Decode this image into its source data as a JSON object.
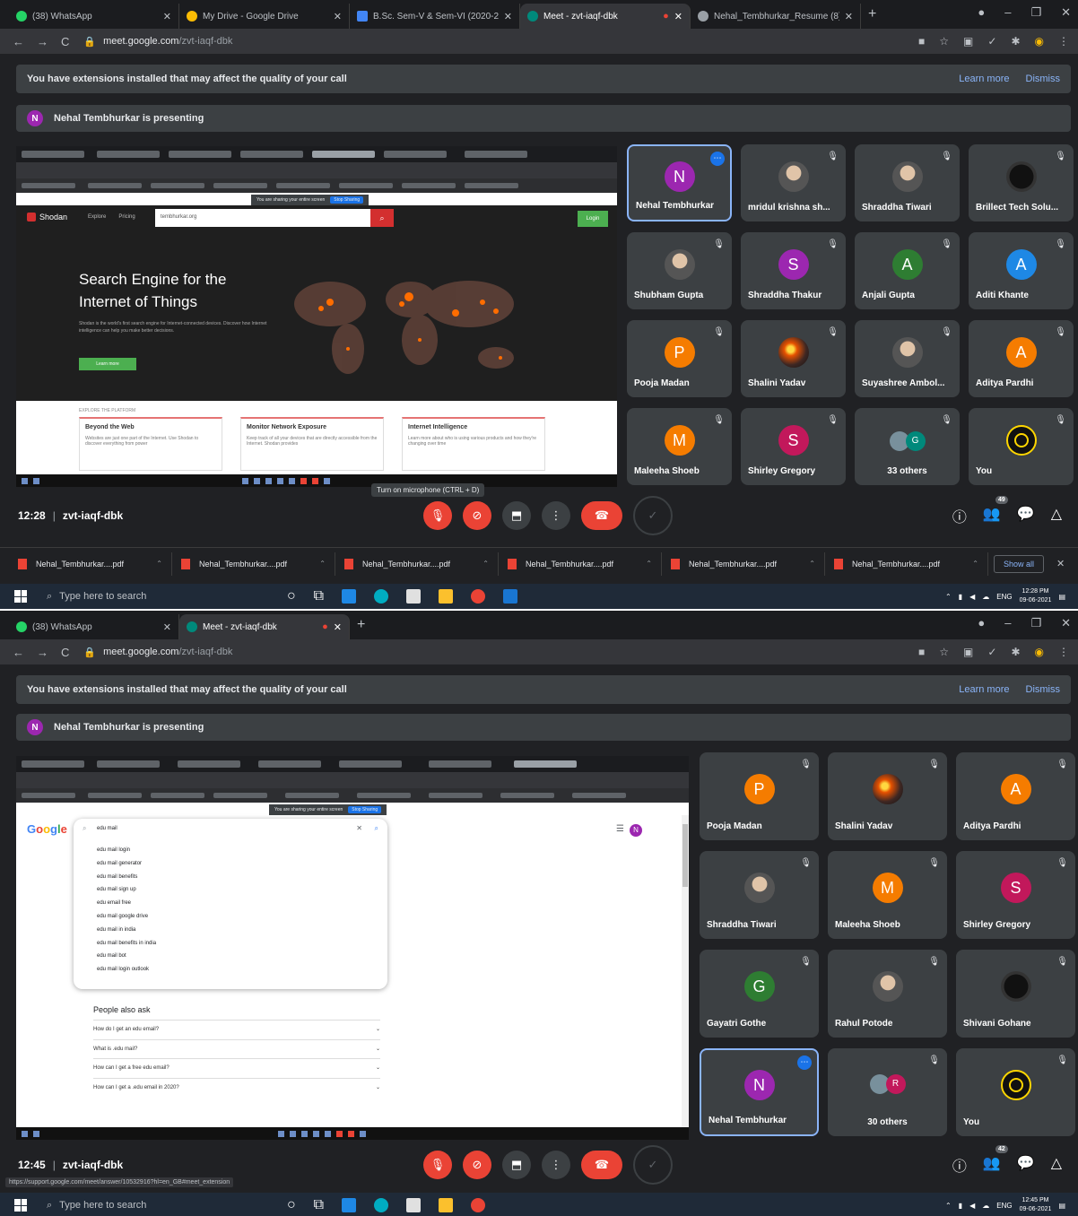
{
  "shot1": {
    "tabs": [
      {
        "label": "(38) WhatsApp",
        "color": "#25d366"
      },
      {
        "label": "My Drive - Google Drive",
        "color": "#fbbc04"
      },
      {
        "label": "B.Sc. Sem-V & Sem-VI (2020-20",
        "color": "#4285f4"
      },
      {
        "label": "Meet - zvt-iaqf-dbk",
        "color": "#00897b"
      },
      {
        "label": "Nehal_Tembhurkar_Resume (8).",
        "color": "#9aa0a6"
      }
    ],
    "url_host": "meet.google.com",
    "url_path": "/zvt-iaqf-dbk",
    "banner_text": "You have extensions installed that may affect the quality of your call",
    "learn_more": "Learn more",
    "dismiss": "Dismiss",
    "presenting_initial": "N",
    "presenting_text": "Nehal Tembhurkar is presenting",
    "shared": {
      "logo": "Shodan",
      "nav": [
        "Explore",
        "Pricing"
      ],
      "search_value": "tembhurkar.org",
      "login": "Login",
      "headline": "Search Engine for the Internet of Things",
      "paragraph": "Shodan is the world's first search engine for Internet-connected devices. Discover how Internet intelligence can help you make better decisions.",
      "learn_btn": "Learn more",
      "explore_label": "EXPLORE THE PLATFORM",
      "cards": [
        {
          "title": "Beyond the Web",
          "text": "Websites are just one part of the Internet. Use Shodan to discover everything from power"
        },
        {
          "title": "Monitor Network Exposure",
          "text": "Keep track of all your devices that are directly accessible from the Internet. Shodan provides"
        },
        {
          "title": "Internet Intelligence",
          "text": "Learn more about who is using various products and how they're changing over time"
        }
      ],
      "sharing_text": "You are sharing your entire screen",
      "stop_sharing": "Stop Sharing"
    },
    "participants": [
      {
        "name": "Nehal Tembhurkar",
        "initial": "N",
        "color": "#9c27b0",
        "kind": "letter",
        "speaking": true
      },
      {
        "name": "mridul krishna sh...",
        "initial": "",
        "color": "#1565c0",
        "kind": "photo"
      },
      {
        "name": "Shraddha Tiwari",
        "initial": "",
        "color": "#795548",
        "kind": "photo"
      },
      {
        "name": "Brillect Tech Solu...",
        "initial": "",
        "color": "#111111",
        "kind": "dark"
      },
      {
        "name": "Shubham Gupta",
        "initial": "",
        "color": "#555555",
        "kind": "photo"
      },
      {
        "name": "Shraddha Thakur",
        "initial": "S",
        "color": "#9c27b0",
        "kind": "letter"
      },
      {
        "name": "Anjali Gupta",
        "initial": "A",
        "color": "#2e7d32",
        "kind": "letter"
      },
      {
        "name": "Aditi Khante",
        "initial": "A",
        "color": "#1e88e5",
        "kind": "letter"
      },
      {
        "name": "Pooja Madan",
        "initial": "P",
        "color": "#f57c00",
        "kind": "letter"
      },
      {
        "name": "Shalini Yadav",
        "initial": "",
        "color": "#e65100",
        "kind": "fire"
      },
      {
        "name": "Suyashree Ambol...",
        "initial": "",
        "color": "#c2185b",
        "kind": "photo"
      },
      {
        "name": "Aditya Pardhi",
        "initial": "A",
        "color": "#f57c00",
        "kind": "letter"
      },
      {
        "name": "Maleeha Shoeb",
        "initial": "M",
        "color": "#f57c00",
        "kind": "letter"
      },
      {
        "name": "Shirley Gregory",
        "initial": "S",
        "color": "#c2185b",
        "kind": "letter"
      },
      {
        "name": "33 others",
        "initial": "G",
        "color": "#00897b",
        "kind": "cluster"
      },
      {
        "name": "You",
        "initial": "",
        "color": "#111111",
        "kind": "logo"
      }
    ],
    "tooltip": "Turn on microphone (CTRL + D)",
    "time": "12:28",
    "meeting_code": "zvt-iaqf-dbk",
    "people_count": "49",
    "downloads": [
      "Nehal_Tembhurkar....pdf",
      "Nehal_Tembhurkar....pdf",
      "Nehal_Tembhurkar....pdf",
      "Nehal_Tembhurkar....pdf",
      "Nehal_Tembhurkar....pdf",
      "Nehal_Tembhurkar....pdf"
    ],
    "show_all": "Show all",
    "taskbar_search": "Type here to search",
    "tray_lang": "ENG",
    "clock_time": "12:28 PM",
    "clock_date": "09-06-2021"
  },
  "shot2": {
    "tabs": [
      {
        "label": "(38) WhatsApp",
        "color": "#25d366"
      },
      {
        "label": "Meet - zvt-iaqf-dbk",
        "color": "#00897b"
      }
    ],
    "url_host": "meet.google.com",
    "url_path": "/zvt-iaqf-dbk",
    "banner_text": "You have extensions installed that may affect the quality of your call",
    "learn_more": "Learn more",
    "dismiss": "Dismiss",
    "presenting_initial": "N",
    "presenting_text": "Nehal Tembhurkar is presenting",
    "shared": {
      "query": "edu mail",
      "suggestions": [
        "edu mail login",
        "edu mail generator",
        "edu mail benefits",
        "edu mail sign up",
        "edu email free",
        "edu mail google drive",
        "edu mail in india",
        "edu mail benefits in india",
        "edu mail bot",
        "edu mail login outlook"
      ],
      "paa_title": "People also ask",
      "paa": [
        "How do I get an edu email?",
        "What is .edu mail?",
        "How can I get a free edu email?",
        "How can I get a .edu email in 2020?"
      ],
      "avatar": "N",
      "sharing_text": "You are sharing your entire screen",
      "stop_sharing": "Stop Sharing"
    },
    "participants": [
      {
        "name": "Pooja Madan",
        "initial": "P",
        "color": "#f57c00",
        "kind": "letter"
      },
      {
        "name": "Shalini Yadav",
        "initial": "",
        "color": "#e65100",
        "kind": "fire"
      },
      {
        "name": "Aditya Pardhi",
        "initial": "A",
        "color": "#f57c00",
        "kind": "letter"
      },
      {
        "name": "Shraddha Tiwari",
        "initial": "",
        "color": "#795548",
        "kind": "photo"
      },
      {
        "name": "Maleeha Shoeb",
        "initial": "M",
        "color": "#f57c00",
        "kind": "letter"
      },
      {
        "name": "Shirley Gregory",
        "initial": "S",
        "color": "#c2185b",
        "kind": "letter"
      },
      {
        "name": "Gayatri Gothe",
        "initial": "G",
        "color": "#2e7d32",
        "kind": "letter"
      },
      {
        "name": "Rahul Potode",
        "initial": "",
        "color": "#607d8b",
        "kind": "photo"
      },
      {
        "name": "Shivani Gohane",
        "initial": "",
        "color": "#000000",
        "kind": "dark"
      },
      {
        "name": "Nehal Tembhurkar",
        "initial": "N",
        "color": "#9c27b0",
        "kind": "letter",
        "speaking": true
      },
      {
        "name": "30 others",
        "initial": "R",
        "color": "#c2185b",
        "kind": "cluster"
      },
      {
        "name": "You",
        "initial": "",
        "color": "#111111",
        "kind": "logo"
      }
    ],
    "time": "12:45",
    "meeting_code": "zvt-iaqf-dbk",
    "people_count": "42",
    "status_url": "https://support.google.com/meet/answer/10532916?hl=en_GB#meet_extension",
    "taskbar_search": "Type here to search",
    "tray_lang": "ENG",
    "clock_time": "12:45 PM",
    "clock_date": "09-06-2021"
  }
}
